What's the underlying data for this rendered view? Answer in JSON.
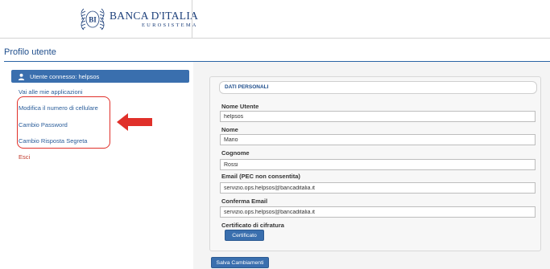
{
  "header": {
    "logo_title": "BANCA D'ITALIA",
    "logo_subtitle": "EUROSISTEMA",
    "logo_monogram": "BI"
  },
  "page": {
    "title": "Profilo utente"
  },
  "sidebar": {
    "user_panel_label": "Utente connesso: helpsos",
    "user_icon": "user-icon",
    "links": [
      {
        "label": "Vai alle mie applicazioni"
      },
      {
        "label": "Modifica il numero di cellulare"
      },
      {
        "label": "Cambio Password"
      },
      {
        "label": "Cambio Risposta Segreta"
      },
      {
        "label": "Esci"
      }
    ],
    "annotation_arrow_color": "#e0302a"
  },
  "form": {
    "section_title": "DATI PERSONALI",
    "fields": [
      {
        "label": "Nome Utente",
        "value": "helpsos"
      },
      {
        "label": "Nome",
        "value": "Mario"
      },
      {
        "label": "Cognome",
        "value": "Rossi"
      },
      {
        "label": "Email (PEC non consentita)",
        "value": "servizio.ops.helpsos@bancaditalia.it"
      },
      {
        "label": "Conferma Email",
        "value": "servizio.ops.helpsos@bancaditalia.it"
      }
    ],
    "certificate_label": "Certificato di cifratura",
    "certificate_button": "Certificato",
    "save_button": "Salva Cambiamenti"
  },
  "colors": {
    "accent": "#3a6fae",
    "link": "#2a5d9a",
    "exit": "#c0392b",
    "annotation": "#e0302a"
  }
}
